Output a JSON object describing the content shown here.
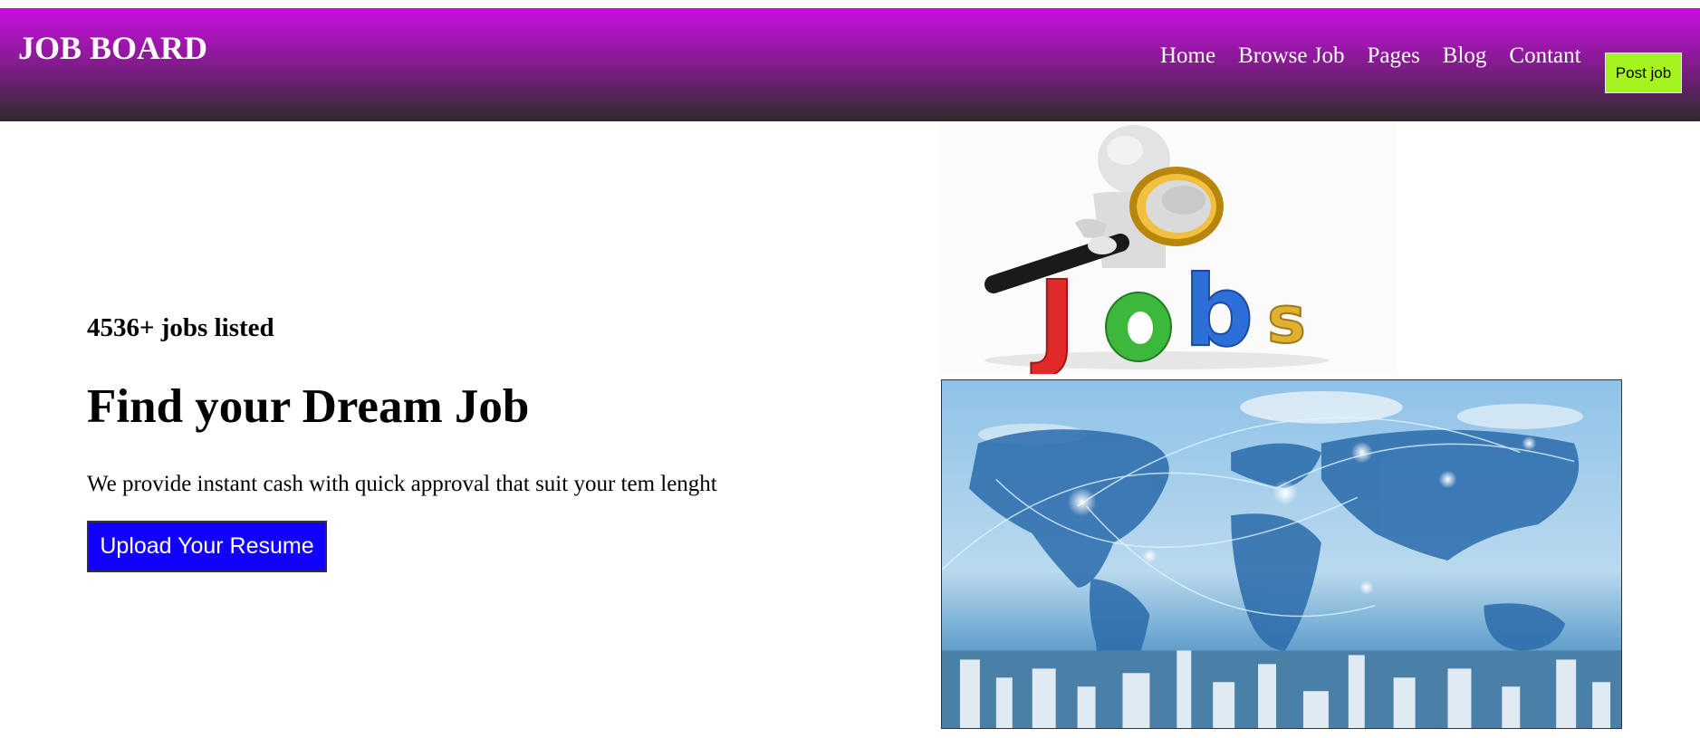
{
  "header": {
    "logo": "JOB BOARD",
    "nav": [
      "Home",
      "Browse Job",
      "Pages",
      "Blog",
      "Contant"
    ],
    "post_button": "Post job"
  },
  "hero": {
    "jobs_count": "4536+ jobs listed",
    "title": "Find your Dream Job",
    "description": "We provide instant cash with quick approval that suit your tem lenght",
    "upload_button": "Upload Your Resume"
  },
  "images": {
    "jobs_illustration_text": "Jobs"
  },
  "colors": {
    "header_top": "#c90fde",
    "header_bottom": "#2d2a2c",
    "post_button_bg": "#a6f41f",
    "upload_button_bg": "#1100ff"
  }
}
